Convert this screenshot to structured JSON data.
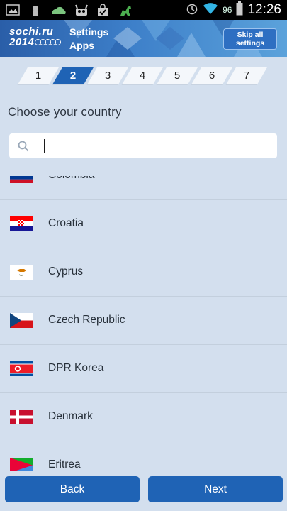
{
  "statusbar": {
    "icons_left": [
      "image-icon",
      "usb-debug-icon",
      "cloud-icon",
      "android-robot-icon",
      "shopping-bag-icon",
      "dino-icon"
    ],
    "battery_percent": "96",
    "time": "12:26"
  },
  "header": {
    "logo_line1": "sochi.ru",
    "logo_line2": "2014",
    "title_line1": "Settings",
    "title_line2": "Apps",
    "skip_label_line1": "Skip all",
    "skip_label_line2": "settings"
  },
  "steps": [
    "1",
    "2",
    "3",
    "4",
    "5",
    "6",
    "7"
  ],
  "active_step": "2",
  "choose_title": "Choose your country",
  "search": {
    "value": "",
    "placeholder": ""
  },
  "countries": [
    {
      "name": "Colombia",
      "flag": "colombia"
    },
    {
      "name": "Croatia",
      "flag": "croatia"
    },
    {
      "name": "Cyprus",
      "flag": "cyprus"
    },
    {
      "name": "Czech Republic",
      "flag": "czech"
    },
    {
      "name": "DPR Korea",
      "flag": "dprk"
    },
    {
      "name": "Denmark",
      "flag": "denmark"
    },
    {
      "name": "Eritrea",
      "flag": "eritrea"
    }
  ],
  "buttons": {
    "back": "Back",
    "next": "Next"
  },
  "colors": {
    "accent": "#1f63b5",
    "background": "#d3dfee"
  }
}
